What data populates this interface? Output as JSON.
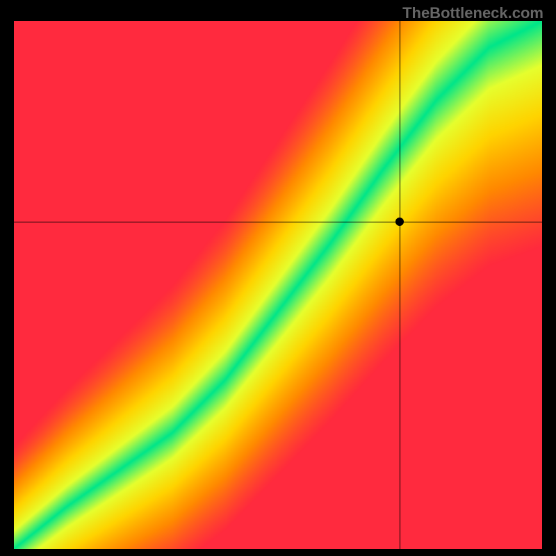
{
  "watermark": "TheBottleneck.com",
  "chart_data": {
    "type": "heatmap",
    "title": "",
    "xlabel": "",
    "ylabel": "",
    "xlim": [
      0,
      100
    ],
    "ylim": [
      0,
      100
    ],
    "marker": {
      "x": 73,
      "y": 62
    },
    "crosshair": {
      "x": 73,
      "y": 62
    },
    "ridge": {
      "description": "green optimal band running diagonally; below the line x-axis resource is bottleneck (reds left), above y-axis resource bottleneck (reds right)",
      "points": [
        {
          "x": 0,
          "y": 0
        },
        {
          "x": 10,
          "y": 8
        },
        {
          "x": 20,
          "y": 15
        },
        {
          "x": 30,
          "y": 22
        },
        {
          "x": 40,
          "y": 32
        },
        {
          "x": 50,
          "y": 45
        },
        {
          "x": 60,
          "y": 58
        },
        {
          "x": 70,
          "y": 72
        },
        {
          "x": 80,
          "y": 85
        },
        {
          "x": 90,
          "y": 95
        },
        {
          "x": 100,
          "y": 100
        }
      ]
    },
    "palette": {
      "low": "#ff2a3e",
      "midlow": "#ff8a00",
      "mid": "#ffd400",
      "midhigh": "#e6ff2e",
      "high": "#00e68a"
    }
  }
}
